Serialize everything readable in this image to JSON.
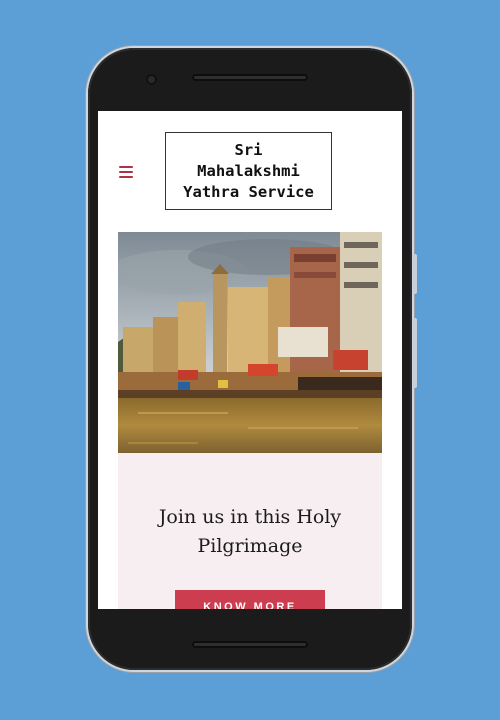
{
  "header": {
    "menu_icon": "hamburger-menu-icon",
    "logo_line1": "Sri",
    "logo_line2": "Mahalakshmi",
    "logo_line3": "Yathra Service",
    "accent_color": "#b03245"
  },
  "hero": {
    "image_subject": "ghats-riverside-photo"
  },
  "cta": {
    "headline_line1": "Join us in this Holy",
    "headline_line2": "Pilgrimage",
    "button_label": "KNOW MORE",
    "button_color": "#cc3d4f",
    "panel_color": "#f7eef1"
  },
  "device": {
    "background_color": "#5b9fd6"
  }
}
